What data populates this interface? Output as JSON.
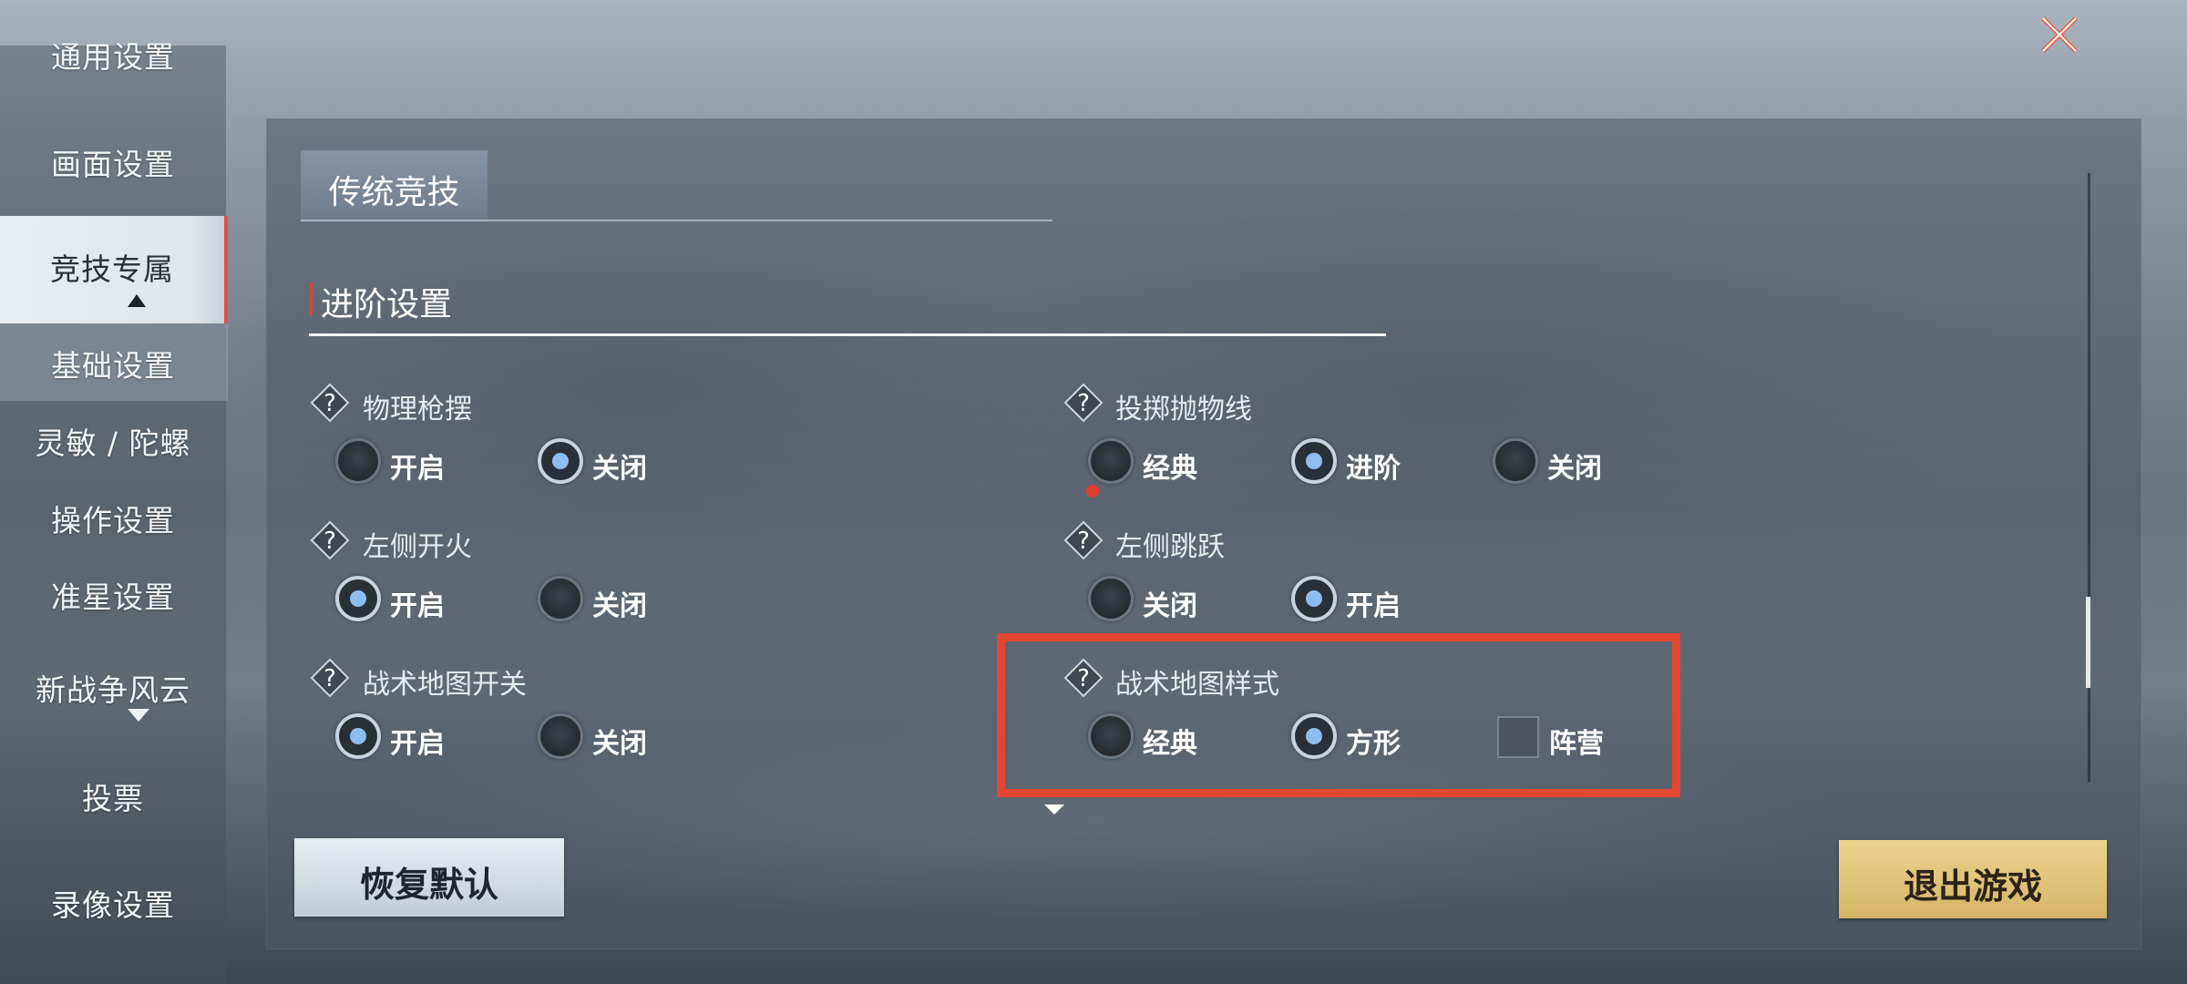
{
  "sidebar": {
    "items": [
      {
        "label": "通用设置"
      },
      {
        "label": "画面设置"
      },
      {
        "label": "竞技专属"
      },
      {
        "label": "基础设置"
      },
      {
        "label": "灵敏 / 陀螺"
      },
      {
        "label": "操作设置"
      },
      {
        "label": "准星设置"
      },
      {
        "label": "新战争风云"
      },
      {
        "label": "投票"
      },
      {
        "label": "录像设置"
      }
    ],
    "active_index": 2,
    "active_sub_index": 3
  },
  "main": {
    "tab_label": "传统竞技",
    "section_title": "进阶设置",
    "settings": [
      {
        "title": "物理枪摆",
        "options": [
          "开启",
          "关闭"
        ],
        "selected": 1
      },
      {
        "title": "投掷抛物线",
        "options": [
          "经典",
          "进阶",
          "关闭"
        ],
        "selected": 1
      },
      {
        "title": "左侧开火",
        "options": [
          "开启",
          "关闭"
        ],
        "selected": 0
      },
      {
        "title": "左侧跳跃",
        "options": [
          "关闭",
          "开启"
        ],
        "selected": 1
      },
      {
        "title": "战术地图开关",
        "options": [
          "开启",
          "关闭"
        ],
        "selected": 0
      },
      {
        "title": "战术地图样式",
        "options": [
          "经典",
          "方形",
          "阵营"
        ],
        "selected": 1,
        "highlighted": true
      }
    ]
  },
  "buttons": {
    "restore_default": "恢复默认",
    "exit_game": "退出游戏"
  },
  "colors": {
    "highlight": "#e2472f",
    "radio_selected_dot": "#8fbcf0",
    "active_marker": "#d7473e",
    "exit_button": "#e2c67c"
  },
  "icons": {
    "close": "close-icon",
    "help": "help-diamond-icon"
  }
}
